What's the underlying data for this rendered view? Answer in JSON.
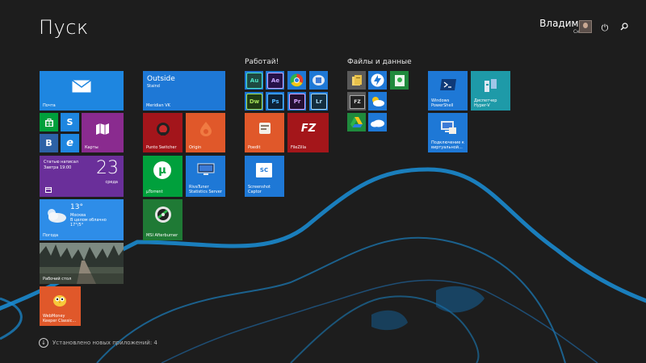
{
  "start": {
    "title": "Пуск"
  },
  "user": {
    "name": "Владимир",
    "subtitle": "Скесов"
  },
  "groups": {
    "work": "Работай!",
    "files": "Файлы и данные"
  },
  "tiles": {
    "mail": {
      "label": "Почта"
    },
    "maps": {
      "label": "Карты"
    },
    "store": {
      "icon": "store-icon"
    },
    "skype": {
      "icon_text": "S"
    },
    "vk": {
      "icon_text": "В"
    },
    "ie": {
      "icon_text": "e"
    },
    "calendar": {
      "line1": "Статью написал",
      "line2": "Завтра 19:00",
      "day": "23",
      "weekday": "среда"
    },
    "weather": {
      "temp": "13°",
      "city": "Москва",
      "cond": "В целом облачно",
      "range": "17°/5°",
      "label": "Погода"
    },
    "desktop": {
      "label": "Рабочий стол"
    },
    "webmoney": {
      "label": "WebMoney\nKeeper Classic..."
    },
    "outside": {
      "title": "Outside",
      "subtitle": "Staind",
      "label": "Meridian VK"
    },
    "punto": {
      "label": "Punto Switcher"
    },
    "origin": {
      "label": "Origin"
    },
    "utorrent": {
      "label": "µTorrent",
      "icon_text": "µ"
    },
    "rivatuner": {
      "label": "RivaTuner\nStatistics Server"
    },
    "msi": {
      "label": "MSI Afterburner"
    },
    "ae": "Ae",
    "au": "Au",
    "dw": "Dw",
    "ps": "Ps",
    "pr": "Pr",
    "lr": "Lr",
    "poedit": {
      "label": "Poedit"
    },
    "filezilla": {
      "label": "FileZilla",
      "icon_text": "FZ"
    },
    "screenshot": {
      "label": "Screenshot\nCaptor",
      "icon_text": "SC"
    },
    "powershell": {
      "label": "Windows\nPowerShell"
    },
    "hyperv": {
      "label": "Диспетчер\nHyper-V"
    },
    "rdp": {
      "label": "Подключение к\nвиртуальной..."
    }
  },
  "footer": {
    "text": "Установлено новых приложений: 4"
  },
  "colors": {
    "blue": "#1e78d6",
    "purple": "#6b2d92",
    "green": "#00a03c",
    "red": "#b81b1b",
    "orange": "#e0582a",
    "dkred": "#a4161a",
    "violet": "#6d3aa8",
    "lightblue": "#2e8de8"
  }
}
